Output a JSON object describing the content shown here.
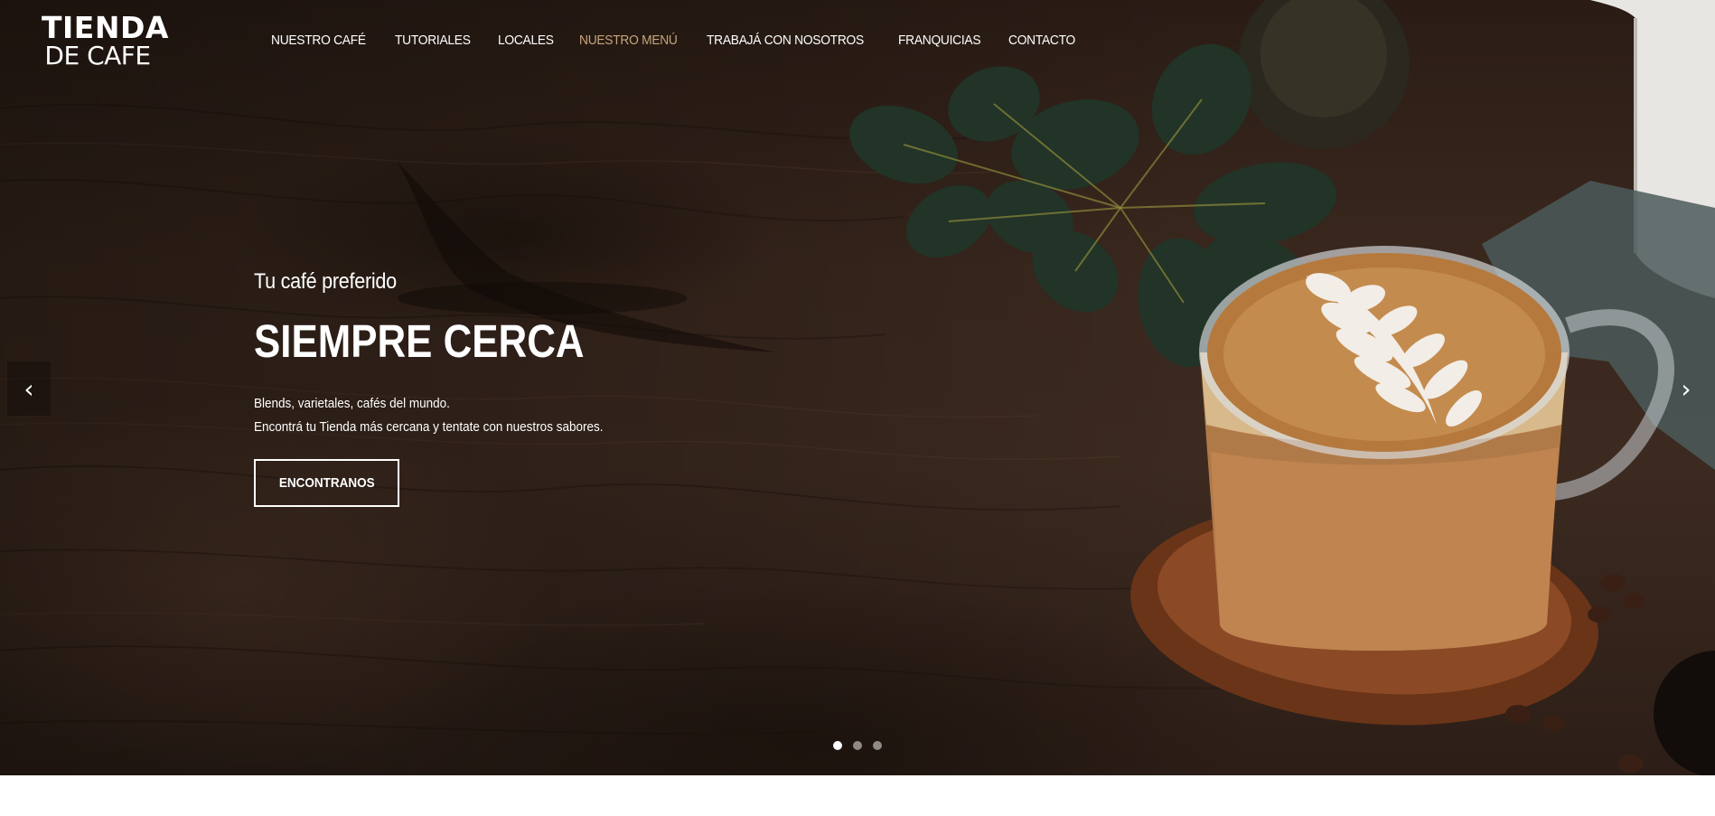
{
  "logo": {
    "line1": "TIENDA",
    "line2": "DE CAFE"
  },
  "nav": {
    "items": [
      {
        "label": "NUESTRO CAFÉ",
        "active": false
      },
      {
        "label": "TUTORIALES",
        "active": false
      },
      {
        "label": "LOCALES",
        "active": false
      },
      {
        "label": "NUESTRO MENÚ",
        "active": true
      },
      {
        "label": "TRABAJÁ CON NOSOTROS",
        "active": false
      },
      {
        "label": "FRANQUICIAS",
        "active": false
      },
      {
        "label": "CONTACTO",
        "active": false
      }
    ]
  },
  "hero": {
    "kicker": "Tu café preferido",
    "headline": "SIEMPRE CERCA",
    "description": [
      "Blends, varietales, cafés del mundo.",
      "Encontrá tu Tienda más cercana y tentate con nuestros sabores."
    ],
    "cta_label": "ENCONTRANOS"
  },
  "carousel": {
    "prev_icon": "‹",
    "next_icon": "›",
    "slide_count": 3,
    "active_slide": 1
  },
  "colors": {
    "accent": "#c8a57c",
    "text": "#ffffff",
    "wood_dark": "#2a1c15",
    "wood_mid": "#3c2a20"
  }
}
